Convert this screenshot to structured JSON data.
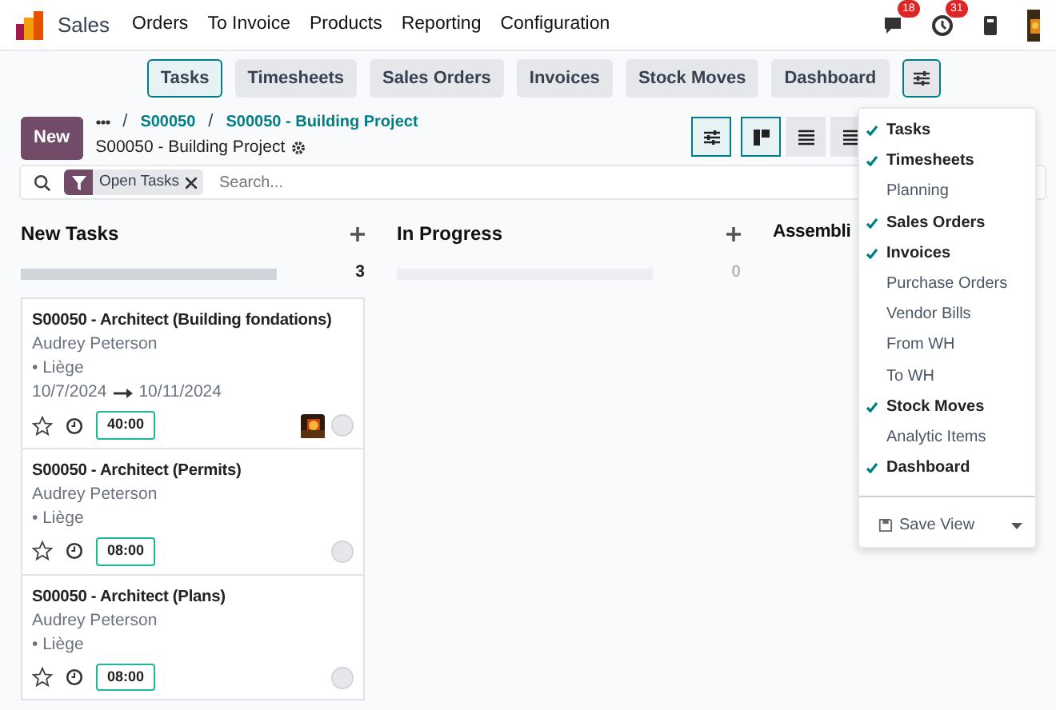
{
  "app": {
    "name": "Sales"
  },
  "menu": [
    "Orders",
    "To Invoice",
    "Products",
    "Reporting",
    "Configuration"
  ],
  "systray": [
    {
      "kind": "chat",
      "badge": "18"
    },
    {
      "kind": "activity",
      "badge": "31"
    },
    {
      "kind": "phone"
    },
    {
      "kind": "avatar"
    }
  ],
  "smart_buttons": [
    {
      "label": "Tasks",
      "selected": true
    },
    {
      "label": "Timesheets",
      "selected": false
    },
    {
      "label": "Sales Orders",
      "selected": false
    },
    {
      "label": "Invoices",
      "selected": false
    },
    {
      "label": "Stock Moves",
      "selected": false
    },
    {
      "label": "Dashboard",
      "selected": false
    }
  ],
  "new_button": "New",
  "breadcrumbs": [
    {
      "separator": "/",
      "label": "S00050"
    },
    {
      "separator": "/",
      "label": "S00050 - Building Project"
    }
  ],
  "title": "S00050 - Building Project",
  "views": [
    {
      "kind": "settings",
      "selected": true
    },
    {
      "kind": "kanban",
      "selected": true
    },
    {
      "kind": "list",
      "selected": false
    },
    {
      "kind": "list",
      "selected": false
    }
  ],
  "search": {
    "facet": "Open Tasks",
    "placeholder": "Search..."
  },
  "columns": [
    {
      "title": "New Tasks",
      "count": "3",
      "level": 1,
      "cards": [
        {
          "title": "S00050 - Architect (Building fondations)",
          "assignee": "Audrey Peterson",
          "tag": "• Liège",
          "start": "10/7/2024",
          "end": "10/11/2024",
          "hours": "40:00",
          "starred": false,
          "avatar": true
        },
        {
          "title": "S00050 - Architect (Permits)",
          "assignee": "Audrey Peterson",
          "tag": "• Liège",
          "hours": "08:00",
          "starred": false,
          "avatar": false
        },
        {
          "title": "S00050 - Architect (Plans)",
          "assignee": "Audrey Peterson",
          "tag": "• Liège",
          "hours": "08:00",
          "starred": false,
          "avatar": false
        }
      ]
    },
    {
      "title": "In Progress",
      "count": "0",
      "level": 0
    },
    {
      "title": "Assembli"
    }
  ],
  "dropdown": {
    "items": [
      {
        "label": "Tasks",
        "checked": true
      },
      {
        "label": "Timesheets",
        "checked": true
      },
      {
        "label": "Planning",
        "checked": false
      },
      {
        "label": "Sales Orders",
        "checked": true
      },
      {
        "label": "Invoices",
        "checked": true
      },
      {
        "label": "Purchase Orders",
        "checked": false
      },
      {
        "label": "Vendor Bills",
        "checked": false
      },
      {
        "label": "From WH",
        "checked": false
      },
      {
        "label": "To WH",
        "checked": false
      },
      {
        "label": "Stock Moves",
        "checked": true
      },
      {
        "label": "Analytic Items",
        "checked": false
      },
      {
        "label": "Dashboard",
        "checked": true
      }
    ],
    "save_view": "Save View"
  }
}
